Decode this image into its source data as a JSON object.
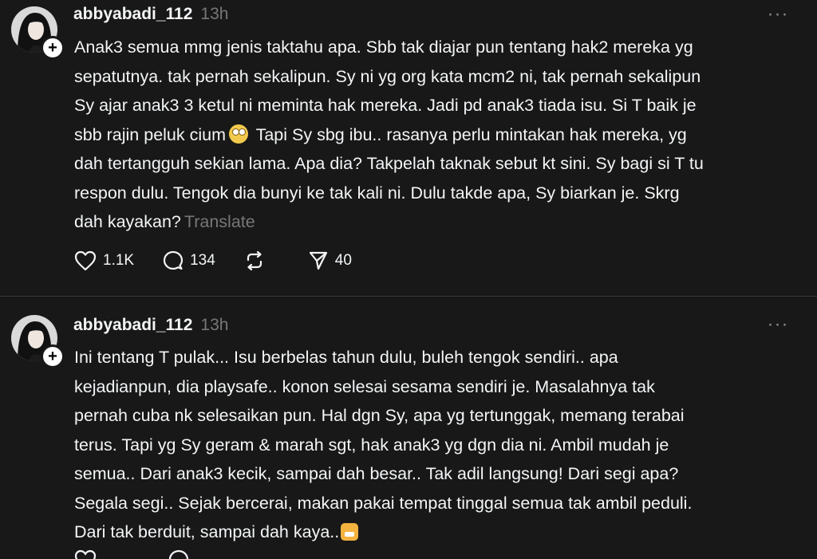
{
  "posts": [
    {
      "username": "abbyabadi_112",
      "timestamp": "13h",
      "more_label": "···",
      "follow_label": "+",
      "text_parts": [
        "Anak3 semua mmg jenis taktahu apa. Sbb tak diajar pun tentang hak2 mereka yg\nsepatutnya. tak pernah sekalipun. Sy ni yg org kata mcm2 ni, tak pernah sekalipun\nSy ajar anak3 3 ketul ni meminta hak mereka. Jadi pd anak3 tiada isu. Si T baik je\nsbb rajin peluk cium",
        " Tapi Sy sbg ibu.. rasanya perlu mintakan hak mereka, yg\ndah tertangguh sekian lama. Apa dia? Takpelah taknak sebut kt sini. Sy bagi si T tu\nrespon dulu. Tengok dia bunyi ke tak kali ni. Dulu takde apa, Sy biarkan je. Skrg\ndah kayakan?"
      ],
      "emoji": "rolling-eyes-emoji",
      "translate_label": "Translate",
      "likes": "1.1K",
      "replies": "134",
      "shares": "40"
    },
    {
      "username": "abbyabadi_112",
      "timestamp": "13h",
      "more_label": "···",
      "follow_label": "+",
      "text": "Ini tentang T pulak... Isu berbelas tahun dulu, buleh tengok sendiri.. apa\nkejadianpun, dia playsafe.. konon selesai sesama sendiri je. Masalahnya tak\npernah cuba nk selesaikan pun. Hal dgn Sy, apa yg tertunggak, memang terabai\nterus. Tapi yg Sy geram & marah sgt, hak anak3 yg dgn dia ni. Ambil mudah je\nsemua.. Dari anak3 kecik, sampai dah besar.. Tak adil langsung! Dari segi apa?\nSegala segi.. Sejak bercerai, makan pakai tempat tinggal semua tak ambil peduli.\nDari tak berduit, sampai dah kaya..",
      "emoji": "steaming-angry-emoji"
    }
  ],
  "icons": {
    "like": "heart-icon",
    "reply": "comment-icon",
    "repost": "repost-icon",
    "share": "send-icon",
    "more": "more-icon"
  },
  "colors": {
    "background": "#181818",
    "text": "#f3f5f7",
    "muted": "#777777",
    "divider": "#333638"
  }
}
